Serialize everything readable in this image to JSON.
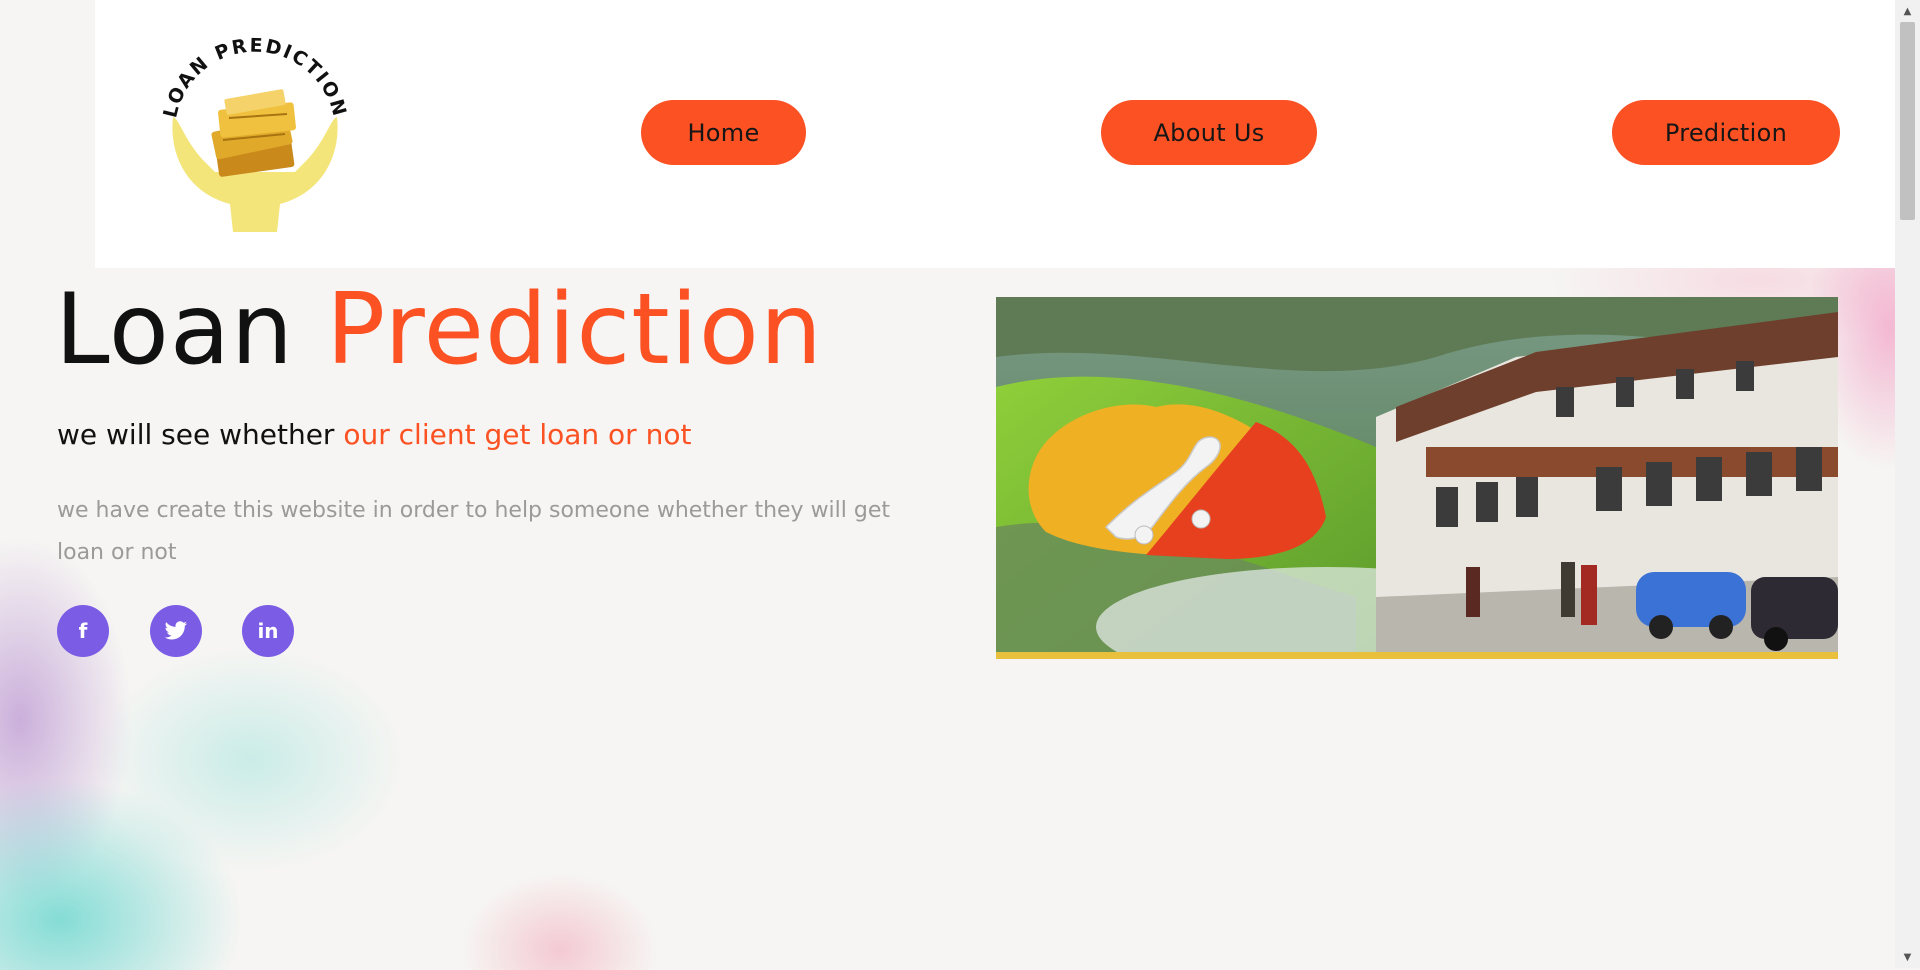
{
  "logo": {
    "arc_text": "LOAN PREDICTION"
  },
  "nav": {
    "items": [
      {
        "label": "Home"
      },
      {
        "label": "About Us"
      },
      {
        "label": "Prediction"
      }
    ]
  },
  "hero": {
    "title_plain": "Loan",
    "title_accent": "Prediction",
    "subtitle_plain": "we will see whether",
    "subtitle_accent": "our client get loan or not",
    "description": "we have create this website in order to help someone whether they will get loan or not"
  },
  "social": [
    {
      "icon": "facebook-icon",
      "glyph": "f"
    },
    {
      "icon": "twitter-icon",
      "glyph": "t"
    },
    {
      "icon": "linkedin-icon",
      "glyph": "in"
    }
  ],
  "colors": {
    "accent": "#fb5123",
    "social": "#7b5ce5",
    "background": "#f6f5f3",
    "logo_hands": "#f3e57a",
    "image_border": "#e9c03c"
  },
  "icons": {
    "scroll_up": "scroll-up-arrow-icon",
    "scroll_down": "scroll-down-arrow-icon"
  }
}
